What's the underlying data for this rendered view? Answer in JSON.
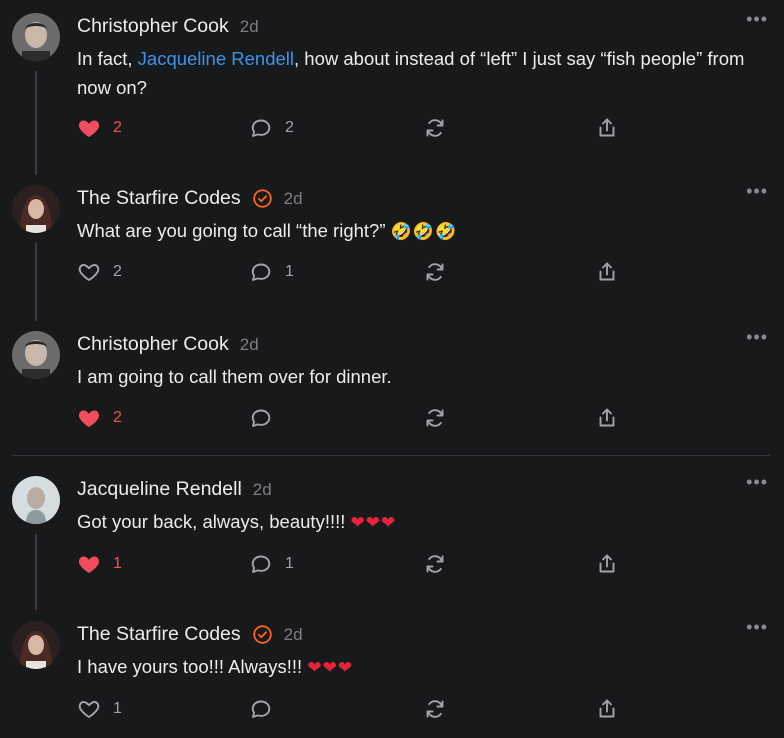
{
  "comments": [
    {
      "author": "Christopher Cook",
      "time": "2d",
      "verified": false,
      "text_prefix": "In fact, ",
      "mention": "Jacqueline Rendell",
      "text_suffix": ", how about instead of “left” I just say “fish people” from now on?",
      "likes": "2",
      "liked": true,
      "replies": "2"
    },
    {
      "author": "The Starfire Codes",
      "time": "2d",
      "verified": true,
      "text": "What are you going to call “the right?”",
      "emoji": "🤣🤣🤣",
      "likes": "2",
      "liked": false,
      "replies": "1"
    },
    {
      "author": "Christopher Cook",
      "time": "2d",
      "verified": false,
      "text": "I am going to call them over for dinner.",
      "likes": "2",
      "liked": true,
      "replies": ""
    },
    {
      "author": "Jacqueline Rendell",
      "time": "2d",
      "verified": false,
      "text": "Got your back, always, beauty!!!!",
      "emoji": "❤❤❤",
      "likes": "1",
      "liked": true,
      "replies": "1"
    },
    {
      "author": "The Starfire Codes",
      "time": "2d",
      "verified": true,
      "text": "I have yours too!!! Always!!!",
      "emoji": "❤❤❤",
      "likes": "1",
      "liked": false,
      "replies": ""
    }
  ],
  "icons": {
    "more": "more-options-icon",
    "like": "heart-icon",
    "reply": "comment-bubble-icon",
    "restack": "restack-icon",
    "share": "share-icon",
    "verified": "verified-check-icon"
  },
  "colors": {
    "background": "#18191b",
    "mention": "#3c93e8",
    "liked": "#f24d5e",
    "verified": "#ff6719"
  }
}
